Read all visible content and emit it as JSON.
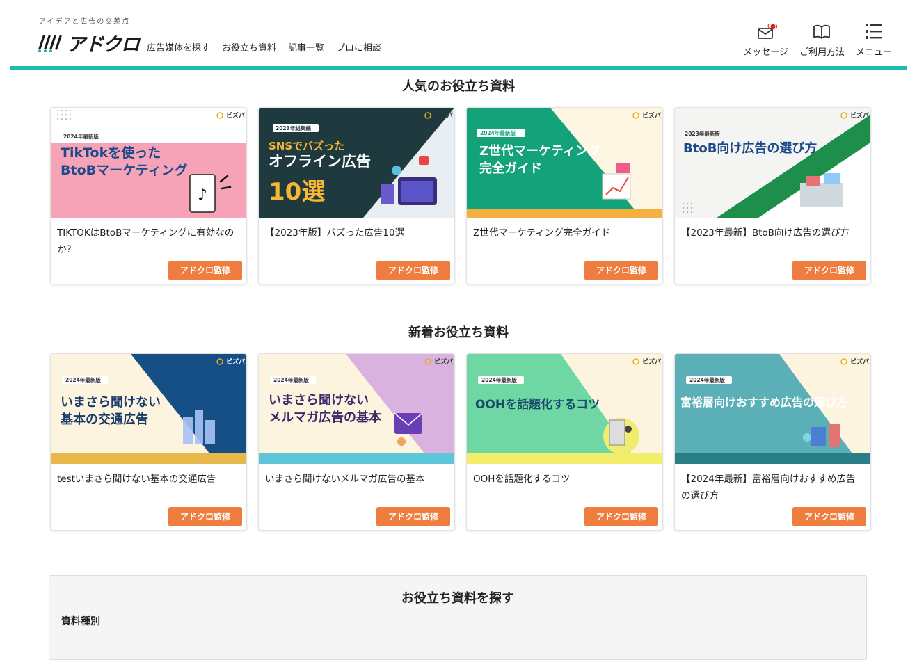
{
  "header": {
    "tagline": "アイデアと広告の交差点",
    "logo_text": "アドクロ",
    "nav": [
      "広告媒体を探す",
      "お役立ち資料",
      "記事一覧",
      "プロに相談"
    ],
    "icons": [
      {
        "label": "メッセージ",
        "icon": "mail-icon"
      },
      {
        "label": "ご利用方法",
        "icon": "book-icon"
      },
      {
        "label": "メニュー",
        "icon": "menu-icon"
      }
    ],
    "accent_color": "#1dbcae"
  },
  "popular": {
    "title": "人気のお役立ち資料",
    "cards": [
      {
        "badge": "2024年最新版",
        "thumb_lines": [
          "TikTokを使った",
          "BtoBマーケティング"
        ],
        "title": "TIKTOKはBtoBマーケティングに有効なのか？",
        "tag": "アドクロ監修",
        "brand": "ビズパ"
      },
      {
        "badge": "2023年総集編",
        "thumb_lines": [
          "SNSでバズった",
          "オフライン広告",
          "10選"
        ],
        "title": "【2023年版】バズった広告10選",
        "tag": "アドクロ監修",
        "brand": "ビズパ"
      },
      {
        "badge": "2024年最新版",
        "thumb_lines": [
          "Z世代マーケティング",
          "完全ガイド"
        ],
        "title": "Z世代マーケティング完全ガイド",
        "tag": "アドクロ監修",
        "brand": "ビズパ"
      },
      {
        "badge": "2023年最新版",
        "thumb_lines": [
          "BtoB向け広告の選び方"
        ],
        "title": "【2023年最新】BtoB向け広告の選び方",
        "tag": "アドクロ監修",
        "brand": "ビズパ"
      }
    ]
  },
  "new": {
    "title": "新着お役立ち資料",
    "cards": [
      {
        "badge": "2024年最新版",
        "thumb_lines": [
          "いまさら聞けない",
          "基本の交通広告"
        ],
        "title": "testいまさら聞けない基本の交通広告",
        "tag": "アドクロ監修",
        "brand": "ビズパ"
      },
      {
        "badge": "2024年最新版",
        "thumb_lines": [
          "いまさら聞けない",
          "メルマガ広告の基本"
        ],
        "title": "いまさら聞けないメルマガ広告の基本",
        "tag": "アドクロ監修",
        "brand": "ビズパ"
      },
      {
        "badge": "2024年最新版",
        "thumb_lines": [
          "OOHを話題化するコツ"
        ],
        "title": "OOHを話題化するコツ",
        "tag": "アドクロ監修",
        "brand": "ビズパ"
      },
      {
        "badge": "2024年最新版",
        "thumb_lines": [
          "富裕層向けおすすめ広告の選び方"
        ],
        "title": "【2024年最新】富裕層向けおすすめ広告の選び方",
        "tag": "アドクロ監修",
        "brand": "ビズパ"
      }
    ]
  },
  "search": {
    "title": "お役立ち資料を探す",
    "label": "資料種別"
  }
}
